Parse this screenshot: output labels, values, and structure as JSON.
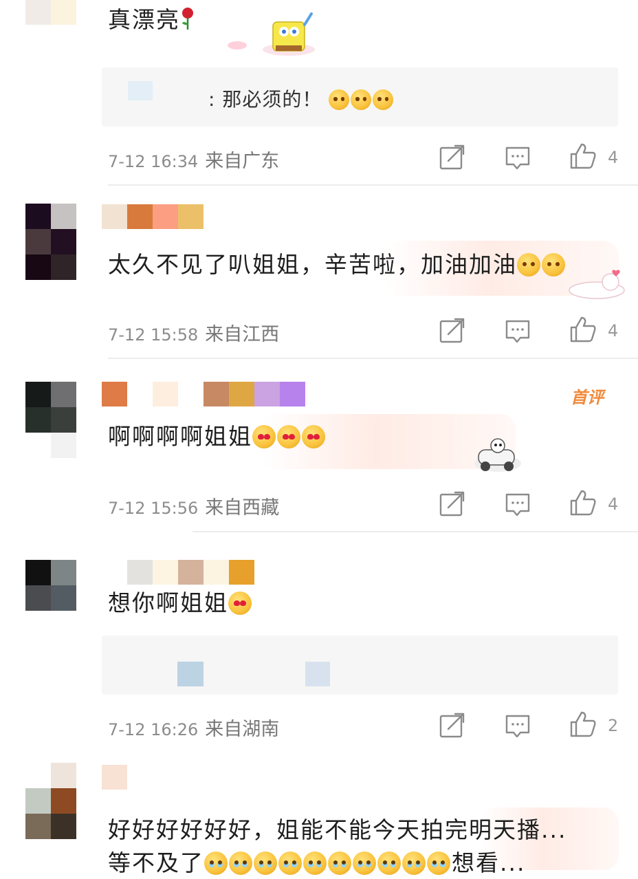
{
  "comments": [
    {
      "text": "真漂亮",
      "reply": {
        "text": ": 那必须的！"
      },
      "time": "7-12 16:34",
      "location": "来自广东",
      "likes": "4"
    },
    {
      "text": "太久不见了叭姐姐，辛苦啦，加油加油",
      "time": "7-12 15:58",
      "location": "来自江西",
      "likes": "4"
    },
    {
      "text": "啊啊啊啊姐姐",
      "badge": "首评",
      "time": "7-12 15:56",
      "location": "来自西藏",
      "likes": "4"
    },
    {
      "text": "想你啊姐姐",
      "time": "7-12 16:26",
      "location": "来自湖南",
      "likes": "2"
    },
    {
      "text_line1": "好好好好好好，姐能不能今天拍完明天播...",
      "text_line2_a": "等不及了",
      "text_line2_b": "想看..."
    }
  ],
  "icons": {
    "share": "share-icon",
    "comment": "comment-icon",
    "like": "thumbs-up-icon"
  },
  "colors": {
    "badge": "#f08a3c",
    "meta": "#8c8c8c",
    "divider": "#ececec"
  }
}
